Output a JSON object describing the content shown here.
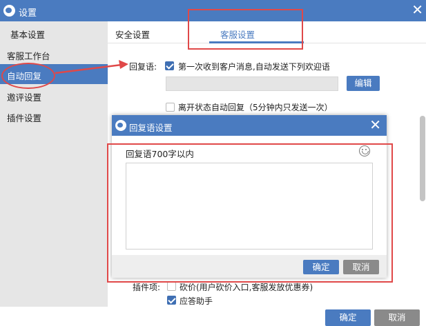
{
  "window": {
    "title": "设置",
    "close_glyph": "✕"
  },
  "tabs": {
    "basic": "基本设置",
    "security": "安全设置",
    "service": "客服设置"
  },
  "sidebar": {
    "items": [
      {
        "label": "客服工作台"
      },
      {
        "label": "自动回复"
      },
      {
        "label": "邀评设置"
      },
      {
        "label": "插件设置"
      }
    ]
  },
  "content": {
    "reply_label": "回复语:",
    "first_msg_checkbox": "第一次收到客户消息,自动发送下列欢迎语",
    "first_msg_checked": true,
    "edit_button": "编辑",
    "away_checkbox": "离开状态自动回复（5分钟内只发送一次）",
    "away_checked": false,
    "plugin_label": "插件项:",
    "bargain_checkbox": "砍价(用户砍价入口,客服发放优惠券)",
    "bargain_checked": false,
    "assistant_checkbox": "应答助手",
    "assistant_checked": true
  },
  "footer": {
    "ok": "确定",
    "cancel": "取消"
  },
  "modal": {
    "title": "回复语设置",
    "close_glyph": "✕",
    "label": "回复语700字以内",
    "textarea_value": "",
    "ok": "确定",
    "cancel": "取消",
    "emoji_icon": "smiley-icon"
  },
  "colors": {
    "accent": "#4a7bc0",
    "annotation_red": "#e04848",
    "sidebar_bg": "#e6e6e6"
  }
}
